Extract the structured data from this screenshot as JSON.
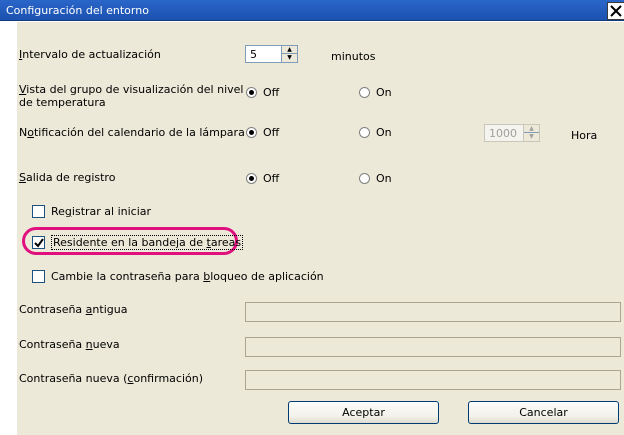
{
  "window": {
    "title": "Configuración del entorno"
  },
  "settings": {
    "interval": {
      "label_pre": "",
      "label_key": "I",
      "label_post": "ntervalo de actualización",
      "value": "5",
      "unit": "minutos"
    },
    "temperature_view": {
      "label_line1_key": "V",
      "label_line1_post": "ista del grupo de visualización del nivel",
      "label_line2": "de temperatura",
      "off_label": "Off",
      "on_label": "On",
      "selected": "Off"
    },
    "lamp_notification": {
      "label_pre": "N",
      "label_key": "o",
      "label_post": "tificación del calendario de la lámpara",
      "off_label": "Off",
      "on_label": "On",
      "selected": "Off",
      "hours_value": "1000",
      "hours_unit": "Hora"
    },
    "log_output": {
      "label_key": "S",
      "label_post": "alida de registro",
      "off_label": "Off",
      "on_label": "On",
      "selected": "Off"
    },
    "log_on_start": {
      "label_pre": "Re",
      "label_key": "g",
      "label_post": "istrar al iniciar",
      "checked": false
    },
    "tray_resident": {
      "label_pre": "Residente en la bandeja de ",
      "label_key": "t",
      "label_post": "areas",
      "checked": true
    },
    "change_password": {
      "label_pre": "Cambie la contraseña para ",
      "label_key": "b",
      "label_post": "loqueo de aplicación",
      "checked": false
    },
    "old_password": {
      "label_pre": "Contraseña ",
      "label_key": "a",
      "label_post": "ntigua",
      "value": ""
    },
    "new_password": {
      "label_pre": "Contraseña ",
      "label_key": "n",
      "label_post": "ueva",
      "value": ""
    },
    "confirm_password": {
      "label_pre": "Contraseña nueva (",
      "label_key": "c",
      "label_post": "onfirmación)",
      "value": ""
    }
  },
  "buttons": {
    "ok": "Aceptar",
    "cancel": "Cancelar"
  },
  "colors": {
    "titlebar": "#1c52b0",
    "dialog_bg": "#ece9d8",
    "highlight": "#e0107f"
  }
}
